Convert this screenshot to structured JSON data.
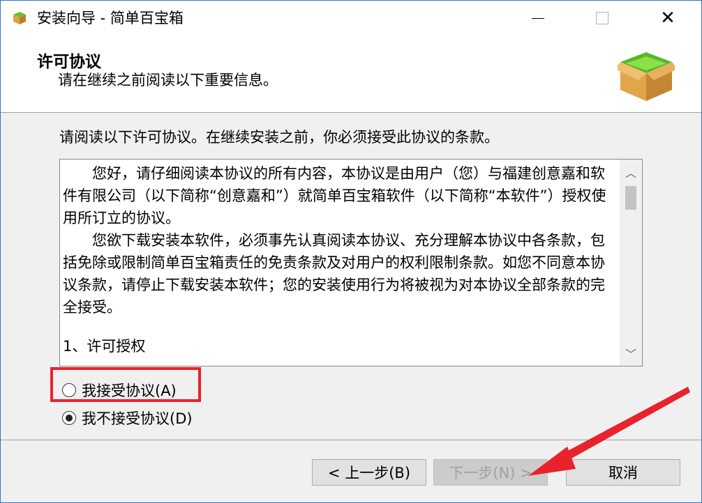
{
  "window": {
    "title": "安装向导 - 简单百宝箱",
    "min_icon": "minimize-icon",
    "max_icon": "maximize-icon",
    "close_icon": "close-icon",
    "close_glyph": "✕"
  },
  "header": {
    "title": "许可协议",
    "subtitle": "请在继续之前阅读以下重要信息。",
    "icon": "software-box-icon"
  },
  "intro": "请阅读以下许可协议。在继续安装之前，你必须接受此协议的条款。",
  "license": {
    "p1": "您好，请仔细阅读本协议的所有内容，本协议是由用户（您）与福建创意嘉和软件有限公司（以下简称“创意嘉和”）就简单百宝箱软件（以下简称“本软件”）授权使用所订立的协议。",
    "p2": "您欲下载安装本软件，必须事先认真阅读本协议、充分理解本协议中各条款，包括免除或限制简单百宝箱责任的免责条款及对用户的权利限制条款。如您不同意本协议条款，请停止下载安装本软件；您的安装使用行为将被视为对本协议全部条款的完全接受。",
    "p3": "1、许可授权",
    "scroll_up_glyph": "︿",
    "scroll_down_glyph": "﹀"
  },
  "radios": [
    {
      "label": "我接受协议(A)",
      "checked": false
    },
    {
      "label": "我不接受协议(D)",
      "checked": true
    }
  ],
  "buttons": {
    "back": "< 上一步(B)",
    "next": "下一步(N) >",
    "cancel": "取消",
    "next_enabled": false
  },
  "annotations": {
    "highlight_color": "#e8232b",
    "arrow_color": "#e8232b"
  }
}
